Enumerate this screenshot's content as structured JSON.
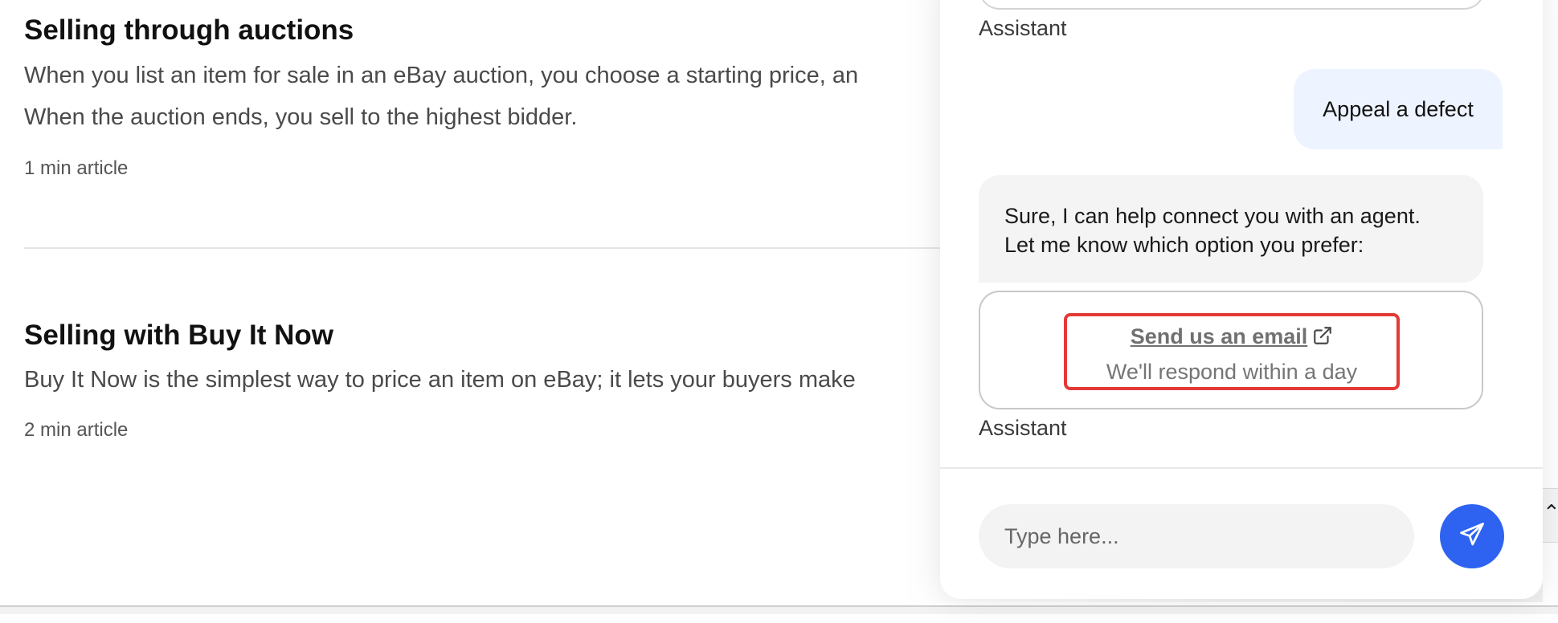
{
  "articles": [
    {
      "title": "Selling through auctions",
      "description_line1": "When you list an item for sale in an eBay auction, you choose a starting price, an",
      "description_line2": "When the auction ends, you sell to the highest bidder.",
      "meta": "1 min article"
    },
    {
      "title": "Selling with Buy It Now",
      "description_line1": "Buy It Now is the simplest way to price an item on eBay; it lets your buyers make",
      "meta": "2 min article"
    }
  ],
  "chat": {
    "messages": [
      {
        "sender": "Assistant"
      },
      {
        "sender": "user",
        "text": "Appeal a defect"
      },
      {
        "sender": "Assistant",
        "text_line1": "Sure, I can help connect you with an agent.",
        "text_line2": "Let me know which option you prefer:",
        "option": {
          "title": "Send us an email",
          "subtitle": "We'll respond within a day",
          "icon": "external-link-icon",
          "highlight_color": "#e53935"
        }
      }
    ],
    "compose": {
      "placeholder": "Type here...",
      "value": "",
      "send_icon": "send-icon",
      "send_color": "#2d63f0"
    }
  }
}
